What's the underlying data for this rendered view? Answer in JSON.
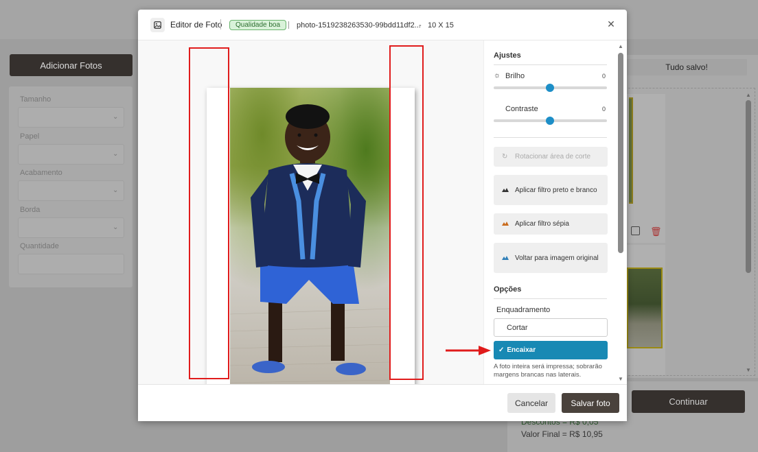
{
  "background": {
    "add_photos_label": "Adicionar Fotos",
    "filters": [
      {
        "label": "Tamanho"
      },
      {
        "label": "Papel"
      },
      {
        "label": "Acabamento"
      },
      {
        "label": "Borda"
      },
      {
        "label": "Quantidade"
      }
    ],
    "saved_status": "Tudo salvo!",
    "continue_label": "Continuar",
    "discount_text": "Descontos = R$ 0,05",
    "final_value_text": "Valor Final = R$ 10,95"
  },
  "modal": {
    "title": "Editor de Foto",
    "quality_badge": "Qualidade boa",
    "filename": "photo-1519238263530-99bdd11df2...",
    "separator": "-",
    "size": "10 X 15",
    "close_glyph": "✕",
    "adjustments": {
      "title": "Ajustes",
      "brightness_label": "Brilho",
      "brightness_value": "0",
      "contrast_label": "Contraste",
      "contrast_value": "0"
    },
    "tools": {
      "rotate_crop": "Rotacionar área de corte",
      "bw_filter": "Aplicar filtro preto e branco",
      "sepia_filter": "Aplicar filtro sépia",
      "restore_original": "Voltar para imagem original"
    },
    "options": {
      "title": "Opções",
      "framing_label": "Enquadramento",
      "crop_option": "Cortar",
      "fit_option": "Encaixar",
      "fit_selected_check": "✓",
      "fit_note": "A foto inteira será impressa; sobrarão margens brancas nas laterais."
    },
    "cancel_label": "Cancelar",
    "save_label": "Salvar foto"
  },
  "colors": {
    "accent": "#1889b4",
    "slider_knob": "#1d8ec7",
    "annotation_red": "#e01b1b",
    "dark_button": "#4a423c",
    "badge_bg": "#d9f2d9"
  }
}
